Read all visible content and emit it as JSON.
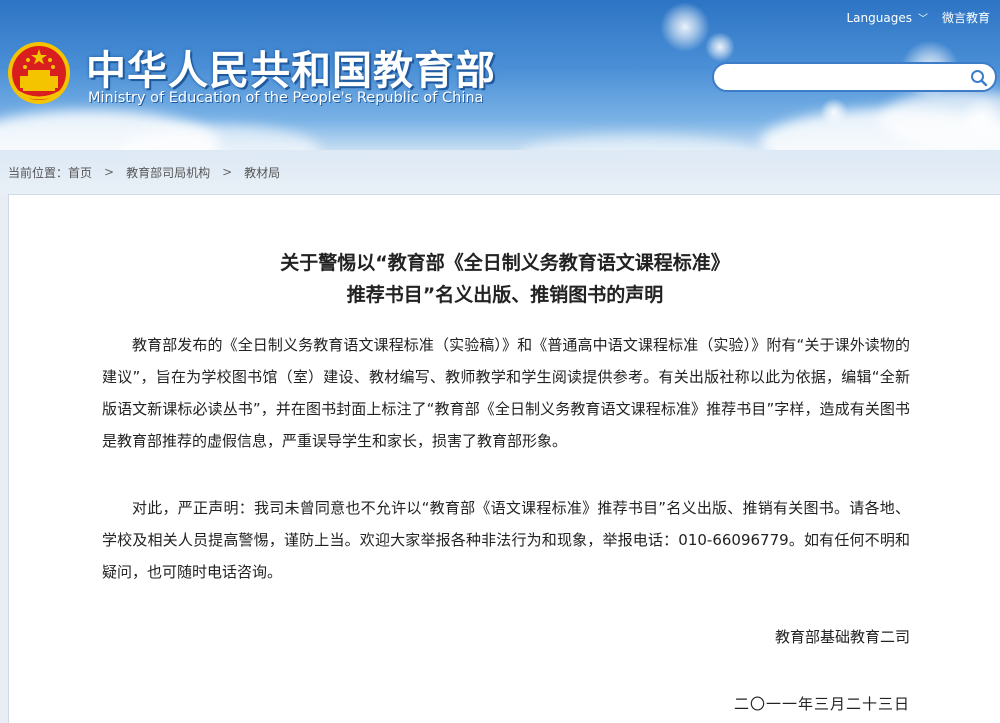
{
  "header": {
    "title_cn": "中华人民共和国教育部",
    "title_en": "Ministry of Education of the People's Republic of China",
    "languages_label": "Languages",
    "weibo_label": "微言教育",
    "search_placeholder": ""
  },
  "breadcrumb": {
    "prefix": "当前位置：",
    "items": [
      "首页",
      "教育部司局机构",
      "教材局"
    ]
  },
  "article": {
    "title_line1": "关于警惕以“教育部《全日制义务教育语文课程标准》",
    "title_line2": "推荐书目”名义出版、推销图书的声明",
    "paragraph1": "教育部发布的《全日制义务教育语文课程标准（实验稿）》和《普通高中语文课程标准（实验）》附有“关于课外读物的建议”，旨在为学校图书馆（室）建设、教材编写、教师教学和学生阅读提供参考。有关出版社称以此为依据，编辑“全新版语文新课标必读丛书”，并在图书封面上标注了“教育部《全日制义务教育语文课程标准》推荐书目”字样，造成有关图书是教育部推荐的虚假信息，严重误导学生和家长，损害了教育部形象。",
    "paragraph2": "对此，严正声明：我司未曾同意也不允许以“教育部《语文课程标准》推荐书目”名义出版、推销有关图书。请各地、学校及相关人员提高警惕，谨防上当。欢迎大家举报各种非法行为和现象，举报电话：010-66096779。如有任何不明和疑问，也可随时电话咨询。",
    "signature": "教育部基础教育二司",
    "date": "二〇一一年三月二十三日"
  },
  "colors": {
    "header_blue": "#2d74c4",
    "emblem_red": "#d81e1e",
    "emblem_gold": "#f5c400"
  }
}
